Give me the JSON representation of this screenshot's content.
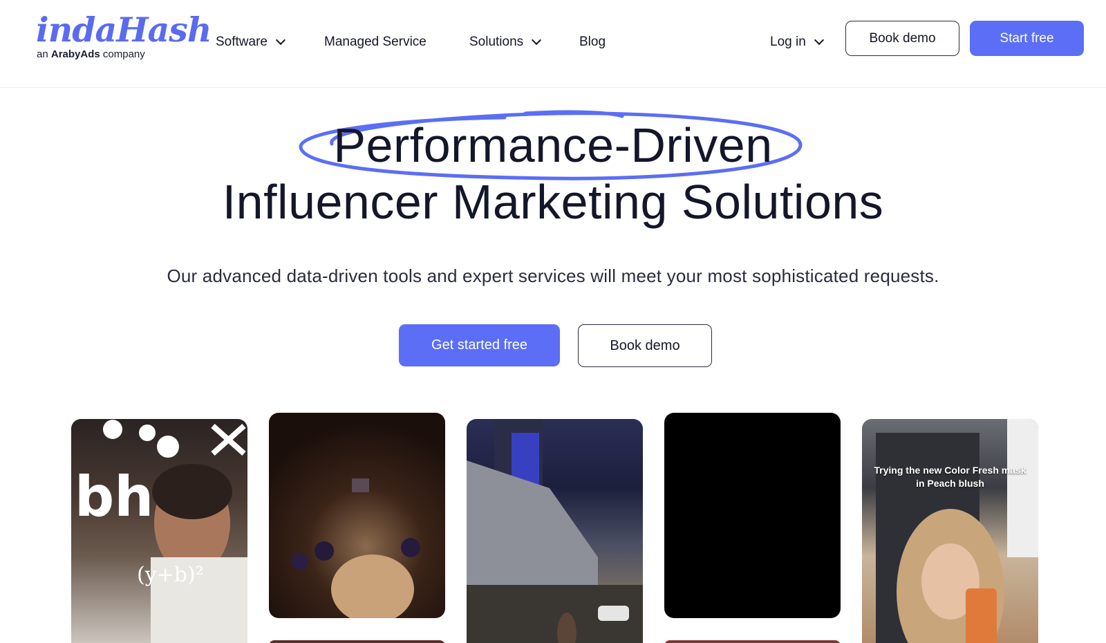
{
  "brand": {
    "name": "indaHash",
    "tagline_prefix": "an",
    "tagline_company": "ArabyAds",
    "tagline_suffix": "company",
    "accent_color": "#5b6ef5"
  },
  "nav": {
    "items": [
      {
        "label": "Software",
        "has_dropdown": true,
        "icon": "chevron-down-icon"
      },
      {
        "label": "Managed Service",
        "has_dropdown": false
      },
      {
        "label": "Solutions",
        "has_dropdown": true,
        "icon": "chevron-down-icon"
      },
      {
        "label": "Blog",
        "has_dropdown": false
      }
    ],
    "login_label": "Log in",
    "book_demo_label": "Book demo",
    "start_free_label": "Start free"
  },
  "hero": {
    "title_line1": "Performance-Driven",
    "title_line2": "Influencer Marketing Solutions",
    "subtitle": "Our advanced data-driven tools and expert services will meet your most sophisticated requests.",
    "primary_cta": "Get started free",
    "secondary_cta": "Book demo"
  },
  "videos": [
    {
      "name": "video-card-chef",
      "caption": ""
    },
    {
      "name": "video-card-party",
      "caption": ""
    },
    {
      "name": "video-card-hotel",
      "caption": ""
    },
    {
      "name": "video-card-black",
      "caption": ""
    },
    {
      "name": "video-card-beauty",
      "caption": "Trying the new Color Fresh mask in Peach blush"
    }
  ]
}
